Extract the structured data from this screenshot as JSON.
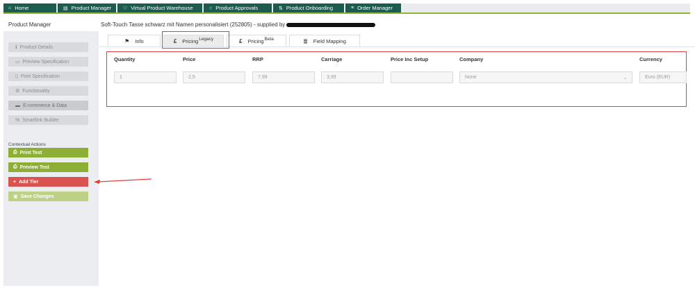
{
  "nav": {
    "items": [
      {
        "icon": "home-icon",
        "glyph": "⌂",
        "label": "Home"
      },
      {
        "icon": "document-icon",
        "glyph": "▤",
        "label": "Product Manager"
      },
      {
        "icon": "heart-icon",
        "glyph": "♡",
        "label": "Virtual Product Warehouse"
      },
      {
        "icon": "thumbs-up-icon",
        "glyph": "☝",
        "label": "Product Approvals"
      },
      {
        "icon": "transfer-icon",
        "glyph": "⇅",
        "label": "Product Onboarding"
      },
      {
        "icon": "list-icon",
        "glyph": "≡",
        "label": "Order Manager"
      }
    ]
  },
  "header": {
    "section": "Product Manager",
    "product_title": "Soft-Touch Tasse schwarz mit Namen personalisiert (252805) - supplied by"
  },
  "sidebar": {
    "items": [
      {
        "glyph": "ℹ",
        "label": "Product Details"
      },
      {
        "glyph": "▭",
        "label": "Preview Specification"
      },
      {
        "glyph": "▯",
        "label": "Print Specification"
      },
      {
        "glyph": "⚙",
        "label": "Functionality"
      },
      {
        "glyph": "▬",
        "label": "E-commerce & Data"
      },
      {
        "glyph": "%",
        "label": "Smartlink Builder"
      }
    ],
    "contextual_label": "Contextual Actions",
    "actions": [
      {
        "glyph": "⎙",
        "label": "Print Test"
      },
      {
        "glyph": "⎙",
        "label": "Preview Test"
      },
      {
        "glyph": "+",
        "label": "Add Tier"
      },
      {
        "glyph": "▣",
        "label": "Save Changes"
      }
    ]
  },
  "tabs": [
    {
      "glyph": "⚑",
      "label": "Info",
      "sup": ""
    },
    {
      "glyph": "£",
      "label": "Pricing",
      "sup": "Legacy"
    },
    {
      "glyph": "£",
      "label": "Pricing",
      "sup": "Beta"
    },
    {
      "glyph": "≣",
      "label": "Field Mapping",
      "sup": ""
    }
  ],
  "pricing": {
    "columns": [
      "Quantity",
      "Price",
      "RRP",
      "Carriage",
      "Price Inc Setup",
      "Company",
      "Currency"
    ],
    "row": {
      "quantity": "1",
      "price": "2,5",
      "rrp": "7,99",
      "carriage": "3,99",
      "price_inc_setup": "",
      "company": "None",
      "currency": "Euro (EUR)"
    }
  },
  "colors": {
    "nav_bg": "#1c5b50",
    "accent_green": "#8daf36",
    "danger_red": "#d9544f",
    "highlight_red": "#e23c3c"
  }
}
